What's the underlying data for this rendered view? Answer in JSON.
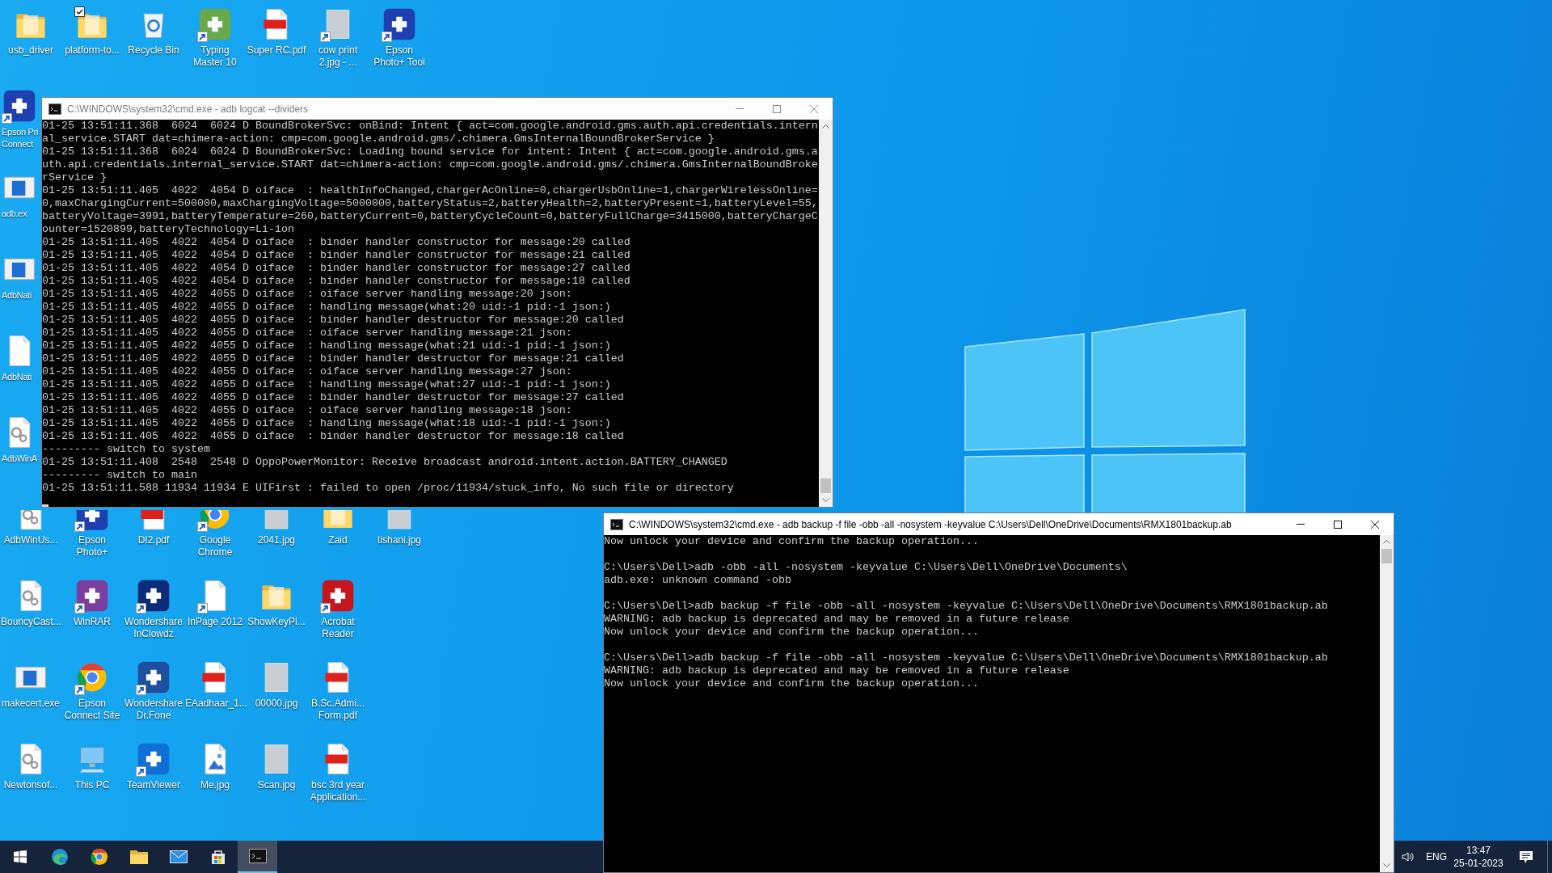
{
  "desktop_rows": [
    {
      "icons": [
        {
          "label": "usb_driver",
          "kind": "folder",
          "shortcut": false,
          "checked": false,
          "cut_off": false,
          "covered": false
        },
        {
          "label": "platform-to...",
          "kind": "folder",
          "shortcut": false,
          "checked": true,
          "cut_off": false,
          "covered": false
        },
        {
          "label": "Recycle Bin",
          "kind": "recycle-bin",
          "shortcut": false,
          "checked": false,
          "cut_off": false,
          "covered": false
        },
        {
          "label": "Typing Master 10",
          "kind": "app",
          "color": "#6aa84f",
          "shortcut": true,
          "checked": false,
          "cut_off": false,
          "covered": false
        },
        {
          "label": "Super RC.pdf",
          "kind": "pdf",
          "shortcut": false,
          "checked": false,
          "cut_off": false,
          "covered": false
        },
        {
          "label": "cow print 2.jpg - ...",
          "kind": "photo",
          "shortcut": true,
          "checked": false,
          "cut_off": false,
          "covered": false
        },
        {
          "label": "Epson Photo+ Tool",
          "kind": "app",
          "color": "#1d3fb0",
          "shortcut": true,
          "checked": false,
          "cut_off": false,
          "covered": false
        }
      ]
    },
    {
      "icons": [
        {
          "label": "Epson Pri Connect",
          "kind": "app",
          "color": "#1d3fb0",
          "shortcut": true,
          "checked": false,
          "cut_off": true,
          "covered": false
        }
      ]
    },
    {
      "icons": [
        {
          "label": "adb.ex",
          "kind": "exe",
          "shortcut": false,
          "checked": false,
          "cut_off": true,
          "covered": false
        }
      ]
    },
    {
      "icons": [
        {
          "label": "AdbNati",
          "kind": "exe",
          "shortcut": false,
          "checked": false,
          "cut_off": true,
          "covered": false
        }
      ]
    },
    {
      "icons": [
        {
          "label": "AdbNati",
          "kind": "blank-file",
          "shortcut": false,
          "checked": false,
          "cut_off": true,
          "covered": false
        }
      ]
    },
    {
      "icons": [
        {
          "label": "AdbWinA",
          "kind": "settings-file",
          "shortcut": false,
          "checked": false,
          "cut_off": true,
          "covered": false
        }
      ]
    },
    {
      "icons": [
        {
          "label": "AdbWinUs...",
          "kind": "settings-file",
          "shortcut": false,
          "checked": false,
          "cut_off": false,
          "covered": true
        },
        {
          "label": "Epson Photo+",
          "kind": "app",
          "color": "#1d3fb0",
          "shortcut": true,
          "checked": false,
          "cut_off": false,
          "covered": true
        },
        {
          "label": "DI2.pdf",
          "kind": "pdf",
          "shortcut": false,
          "checked": false,
          "cut_off": false,
          "covered": true
        },
        {
          "label": "Google Chrome",
          "kind": "chrome",
          "shortcut": true,
          "checked": false,
          "cut_off": false,
          "covered": true
        },
        {
          "label": "2041.jpg",
          "kind": "photo",
          "shortcut": false,
          "checked": false,
          "cut_off": false,
          "covered": true
        },
        {
          "label": "Zaid",
          "kind": "folder",
          "shortcut": false,
          "checked": false,
          "cut_off": false,
          "covered": true
        },
        {
          "label": "tishani.jpg",
          "kind": "photo",
          "shortcut": false,
          "checked": false,
          "cut_off": false,
          "covered": true
        }
      ]
    },
    {
      "icons": [
        {
          "label": "BouncyCast...",
          "kind": "settings-file",
          "shortcut": false,
          "checked": false,
          "cut_off": false,
          "covered": false
        },
        {
          "label": "WinRAR",
          "kind": "app",
          "color": "#7b3fa0",
          "shortcut": true,
          "checked": false,
          "cut_off": false,
          "covered": false
        },
        {
          "label": "Wondershare InClowdz",
          "kind": "app",
          "color": "#0b2a7a",
          "shortcut": true,
          "checked": false,
          "cut_off": false,
          "covered": false
        },
        {
          "label": "InPage 2012",
          "kind": "blank-file",
          "shortcut": true,
          "checked": false,
          "cut_off": false,
          "covered": false
        },
        {
          "label": "ShowKeyPl...",
          "kind": "folder",
          "shortcut": false,
          "checked": false,
          "cut_off": false,
          "covered": false
        },
        {
          "label": "Acrobat Reader",
          "kind": "app",
          "color": "#c4161c",
          "shortcut": true,
          "checked": false,
          "cut_off": false,
          "covered": false
        }
      ]
    },
    {
      "icons": [
        {
          "label": "makecert.exe",
          "kind": "exe",
          "shortcut": false,
          "checked": false,
          "cut_off": false,
          "covered": false
        },
        {
          "label": "Epson Connect Site",
          "kind": "chrome",
          "shortcut": true,
          "checked": false,
          "cut_off": false,
          "covered": false
        },
        {
          "label": "Wondershare Dr.Fone",
          "kind": "app",
          "color": "#1f4fa0",
          "shortcut": true,
          "checked": false,
          "cut_off": false,
          "covered": false
        },
        {
          "label": "EAadhaar_1...",
          "kind": "pdf",
          "shortcut": false,
          "checked": false,
          "cut_off": false,
          "covered": false
        },
        {
          "label": "00000.jpg",
          "kind": "photo",
          "shortcut": false,
          "checked": false,
          "cut_off": false,
          "covered": false
        },
        {
          "label": "B.Sc.Admi... Form.pdf",
          "kind": "pdf",
          "shortcut": false,
          "checked": false,
          "cut_off": false,
          "covered": false
        }
      ]
    },
    {
      "icons": [
        {
          "label": "Newtonsof...",
          "kind": "settings-file",
          "shortcut": false,
          "checked": false,
          "cut_off": false,
          "covered": false
        },
        {
          "label": "This PC",
          "kind": "computer",
          "shortcut": false,
          "checked": false,
          "cut_off": false,
          "covered": false
        },
        {
          "label": "TeamViewer",
          "kind": "app",
          "color": "#0e6fd6",
          "shortcut": true,
          "checked": false,
          "cut_off": false,
          "covered": false
        },
        {
          "label": "Me.jpg",
          "kind": "image-file",
          "shortcut": false,
          "checked": false,
          "cut_off": false,
          "covered": false
        },
        {
          "label": "Scan.jpg",
          "kind": "photo",
          "shortcut": false,
          "checked": false,
          "cut_off": false,
          "covered": false
        },
        {
          "label": "bsc 3rd year Application...",
          "kind": "pdf",
          "shortcut": false,
          "checked": false,
          "cut_off": false,
          "covered": false
        }
      ]
    }
  ],
  "windows": [
    {
      "kind": "log",
      "title": "C:\\WINDOWS\\system32\\cmd.exe - adb  logcat --dividers",
      "active": false,
      "lines": [
        "01-25 13:51:11.368  6024  6024 D BoundBrokerSvc: onBind: Intent { act=com.google.android.gms.auth.api.credentials.internal_service.START dat=chimera-action: cmp=com.google.android.gms/.chimera.GmsInternalBoundBrokerService }",
        "01-25 13:51:11.368  6024  6024 D BoundBrokerSvc: Loading bound service for intent: Intent { act=com.google.android.gms.auth.api.credentials.internal_service.START dat=chimera-action: cmp=com.google.android.gms/.chimera.GmsInternalBoundBrokerService }",
        "01-25 13:51:11.405  4022  4054 D oiface  : healthInfoChanged,chargerAcOnline=0,chargerUsbOnline=1,chargerWirelessOnline=0,maxChargingCurrent=500000,maxChargingVoltage=5000000,batteryStatus=2,batteryHealth=2,batteryPresent=1,batteryLevel=55,batteryVoltage=3991,batteryTemperature=260,batteryCurrent=0,batteryCycleCount=0,batteryFullCharge=3415000,batteryChargeCounter=1520899,batteryTechnology=Li-ion",
        "01-25 13:51:11.405  4022  4054 D oiface  : binder handler constructor for message:20 called",
        "01-25 13:51:11.405  4022  4054 D oiface  : binder handler constructor for message:21 called",
        "01-25 13:51:11.405  4022  4054 D oiface  : binder handler constructor for message:27 called",
        "01-25 13:51:11.405  4022  4054 D oiface  : binder handler constructor for message:18 called",
        "01-25 13:51:11.405  4022  4055 D oiface  : oiface server handling message:20 json:",
        "01-25 13:51:11.405  4022  4055 D oiface  : handling message(what:20 uid:-1 pid:-1 json:)",
        "01-25 13:51:11.405  4022  4055 D oiface  : binder handler destructor for message:20 called",
        "01-25 13:51:11.405  4022  4055 D oiface  : oiface server handling message:21 json:",
        "01-25 13:51:11.405  4022  4055 D oiface  : handling message(what:21 uid:-1 pid:-1 json:)",
        "01-25 13:51:11.405  4022  4055 D oiface  : binder handler destructor for message:21 called",
        "01-25 13:51:11.405  4022  4055 D oiface  : oiface server handling message:27 json:",
        "01-25 13:51:11.405  4022  4055 D oiface  : handling message(what:27 uid:-1 pid:-1 json:)",
        "01-25 13:51:11.405  4022  4055 D oiface  : binder handler destructor for message:27 called",
        "01-25 13:51:11.405  4022  4055 D oiface  : oiface server handling message:18 json:",
        "01-25 13:51:11.405  4022  4055 D oiface  : handling message(what:18 uid:-1 pid:-1 json:)",
        "01-25 13:51:11.405  4022  4055 D oiface  : binder handler destructor for message:18 called",
        "--------- switch to system",
        "01-25 13:51:11.408  2548  2548 D OppoPowerMonitor: Receive broadcast android.intent.action.BATTERY_CHANGED",
        "--------- switch to main",
        "01-25 13:51:11.588 11934 11934 E UIFirst : failed to open /proc/11934/stuck_info, No such file or directory"
      ]
    },
    {
      "kind": "console",
      "title": "C:\\WINDOWS\\system32\\cmd.exe - adb  backup -f file -obb -all -nosystem -keyvalue C:\\Users\\Dell\\OneDrive\\Documents\\RMX1801backup.ab",
      "active": true,
      "blocks": [
        [
          "Now unlock your device and confirm the backup operation..."
        ],
        [
          "C:\\Users\\Dell>adb -obb -all -nosystem -keyvalue C:\\Users\\Dell\\OneDrive\\Documents\\",
          "adb.exe: unknown command -obb"
        ],
        [
          "C:\\Users\\Dell>adb backup -f file -obb -all -nosystem -keyvalue C:\\Users\\Dell\\OneDrive\\Documents\\RMX1801backup.ab",
          "WARNING: adb backup is deprecated and may be removed in a future release",
          "Now unlock your device and confirm the backup operation..."
        ],
        [
          "C:\\Users\\Dell>adb backup -f file -obb -all -nosystem -keyvalue C:\\Users\\Dell\\OneDrive\\Documents\\RMX1801backup.ab",
          "WARNING: adb backup is deprecated and may be removed in a future release",
          "Now unlock your device and confirm the backup operation..."
        ]
      ]
    }
  ],
  "taskbar": {
    "items": [
      {
        "kind": "start",
        "active": false
      },
      {
        "kind": "edge",
        "active": false
      },
      {
        "kind": "chrome",
        "active": false
      },
      {
        "kind": "file-explorer",
        "active": false
      },
      {
        "kind": "mail",
        "active": false
      },
      {
        "kind": "store",
        "active": false
      },
      {
        "kind": "terminal",
        "active": true
      }
    ],
    "language": "ENG",
    "time": "13:47",
    "date": "25-01-2023"
  }
}
